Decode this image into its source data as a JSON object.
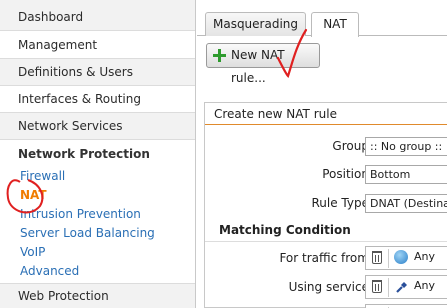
{
  "sidebar": {
    "items": [
      {
        "label": "Dashboard"
      },
      {
        "label": "Management"
      },
      {
        "label": "Definitions & Users"
      },
      {
        "label": "Interfaces & Routing"
      },
      {
        "label": "Network Services"
      }
    ],
    "section_title": "Network Protection",
    "subitems": [
      {
        "label": "Firewall"
      },
      {
        "label": "NAT"
      },
      {
        "label": "Intrusion Prevention"
      },
      {
        "label": "Server Load Balancing"
      },
      {
        "label": "VoIP"
      },
      {
        "label": "Advanced"
      }
    ],
    "bottom_item": "Web Protection"
  },
  "tabs": [
    {
      "label": "Masquerading"
    },
    {
      "label": "NAT"
    }
  ],
  "toolbar": {
    "new_rule_label": "New NAT rule..."
  },
  "panel": {
    "title": "Create new NAT rule",
    "group_label": "Group:",
    "group_value": ":: No group ::",
    "position_label": "Position:",
    "position_value": "Bottom",
    "rule_type_label": "Rule Type:",
    "rule_type_value": "DNAT (Destina",
    "matching_title": "Matching Condition",
    "traffic_from_label": "For traffic from:",
    "traffic_from_value": "Any",
    "service_label": "Using service:",
    "service_value": "Any"
  },
  "colors": {
    "accent": "#f07c00",
    "link": "#2a6fb5",
    "annotation": "#e02020"
  }
}
